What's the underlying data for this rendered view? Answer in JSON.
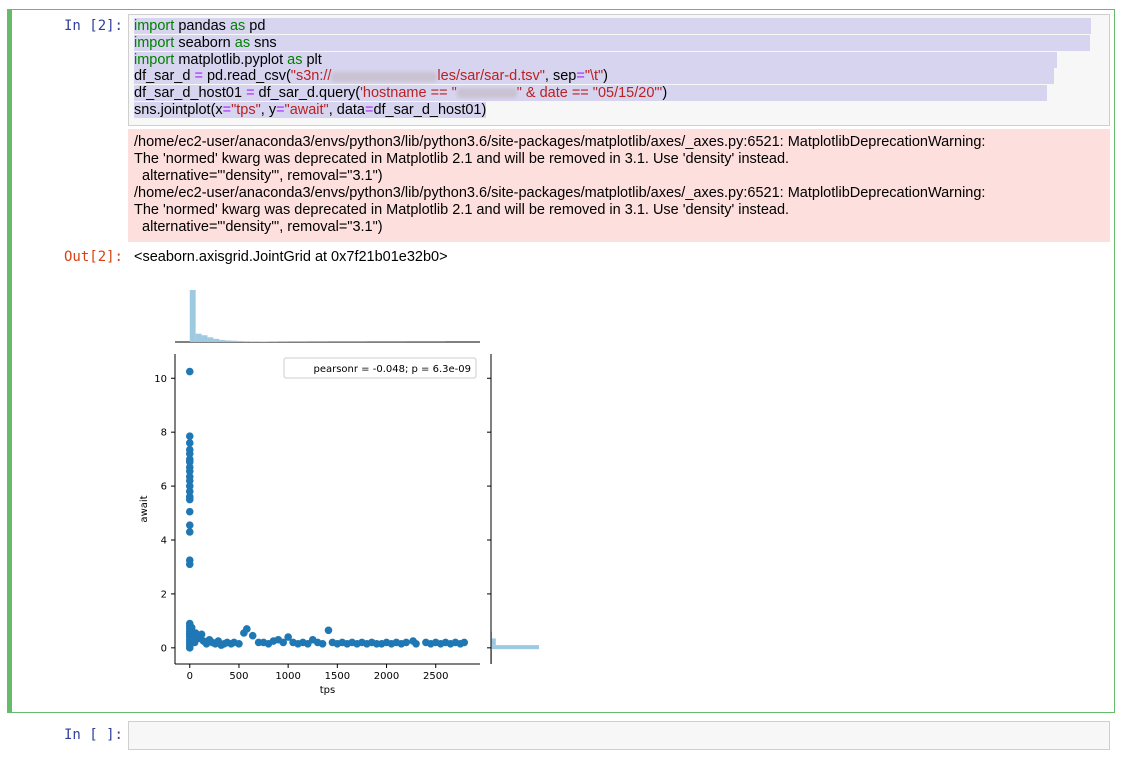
{
  "cell1": {
    "in_prompt": "In [2]:",
    "out_prompt": "Out[2]:",
    "code": {
      "line1": {
        "kw1": "import",
        "mod": " pandas ",
        "kw2": "as",
        "alias": " pd"
      },
      "line2": {
        "kw1": "import",
        "mod": " seaborn ",
        "kw2": "as",
        "alias": " sns"
      },
      "line3": {
        "kw1": "import",
        "mod": " matplotlib.pyplot ",
        "kw2": "as",
        "alias": " plt"
      },
      "line4": {
        "a": "df_sar_d ",
        "op": "=",
        "b": " pd.read_csv(",
        "s1": "\"s3n://",
        "s2": "les/sar/sar-d.tsv\"",
        "c": ", sep",
        "op2": "=",
        "s3": "\"\\t\"",
        "d": ")"
      },
      "line5": {
        "a": "df_sar_d_host01 ",
        "op": "=",
        "b": " df_sar_d.query(",
        "s1": "'hostname == \"",
        "s2": "\" & date == \"05/15/20\"'",
        "d": ")"
      },
      "line6": {
        "a": "sns.jointplot(x",
        "op1": "=",
        "s1": "\"tps\"",
        "b": ", y",
        "op2": "=",
        "s2": "\"await\"",
        "c": ", data",
        "op3": "=",
        "d": "df_sar_d_host01)"
      }
    },
    "stderr_lines": [
      "/home/ec2-user/anaconda3/envs/python3/lib/python3.6/site-packages/matplotlib/axes/_axes.py:6521: MatplotlibDeprecationWarning:",
      "The 'normed' kwarg was deprecated in Matplotlib 2.1 and will be removed in 3.1. Use 'density' instead.",
      "  alternative=\"'density'\", removal=\"3.1\")",
      "/home/ec2-user/anaconda3/envs/python3/lib/python3.6/site-packages/matplotlib/axes/_axes.py:6521: MatplotlibDeprecationWarning:",
      "The 'normed' kwarg was deprecated in Matplotlib 2.1 and will be removed in 3.1. Use 'density' instead.",
      "  alternative=\"'density'\", removal=\"3.1\")"
    ],
    "output_text": "<seaborn.axisgrid.JointGrid at 0x7f21b01e32b0>"
  },
  "cell2": {
    "in_prompt": "In [ ]:"
  },
  "chart_data": {
    "type": "scatter",
    "title": "",
    "xlabel": "tps",
    "ylabel": "await",
    "xlim": [
      -150,
      2950
    ],
    "ylim": [
      -0.6,
      10.9
    ],
    "xticks": [
      0,
      500,
      1000,
      1500,
      2000,
      2500
    ],
    "yticks": [
      0,
      2,
      4,
      6,
      8,
      10
    ],
    "annotation": "pearsonr = -0.048; p = 6.3e-09",
    "legend_position": "top-right",
    "grid": false,
    "colors": {
      "points": "#1f77b4",
      "hist": "#9ecae1"
    },
    "points": [
      [
        0,
        10.25
      ],
      [
        0,
        7.85
      ],
      [
        0,
        7.6
      ],
      [
        0,
        7.35
      ],
      [
        0,
        7.2
      ],
      [
        0,
        7.0
      ],
      [
        0,
        6.9
      ],
      [
        0,
        6.7
      ],
      [
        0,
        6.55
      ],
      [
        0,
        6.35
      ],
      [
        0,
        6.2
      ],
      [
        0,
        6.0
      ],
      [
        0,
        5.8
      ],
      [
        0,
        5.6
      ],
      [
        0,
        5.5
      ],
      [
        0,
        5.05
      ],
      [
        0,
        4.55
      ],
      [
        0,
        4.3
      ],
      [
        0,
        3.25
      ],
      [
        0,
        3.1
      ],
      [
        0,
        0.9
      ],
      [
        0,
        0.8
      ],
      [
        0,
        0.7
      ],
      [
        0,
        0.6
      ],
      [
        0,
        0.5
      ],
      [
        0,
        0.4
      ],
      [
        0,
        0.3
      ],
      [
        0,
        0.2
      ],
      [
        0,
        0.1
      ],
      [
        0,
        0.0
      ],
      [
        20,
        0.75
      ],
      [
        30,
        0.5
      ],
      [
        40,
        0.3
      ],
      [
        50,
        0.2
      ],
      [
        60,
        0.55
      ],
      [
        80,
        0.4
      ],
      [
        100,
        0.35
      ],
      [
        120,
        0.5
      ],
      [
        140,
        0.25
      ],
      [
        170,
        0.15
      ],
      [
        200,
        0.3
      ],
      [
        230,
        0.2
      ],
      [
        260,
        0.15
      ],
      [
        290,
        0.25
      ],
      [
        320,
        0.1
      ],
      [
        350,
        0.15
      ],
      [
        380,
        0.2
      ],
      [
        420,
        0.15
      ],
      [
        450,
        0.2
      ],
      [
        500,
        0.15
      ],
      [
        550,
        0.55
      ],
      [
        580,
        0.7
      ],
      [
        640,
        0.45
      ],
      [
        700,
        0.2
      ],
      [
        750,
        0.2
      ],
      [
        800,
        0.15
      ],
      [
        850,
        0.25
      ],
      [
        900,
        0.3
      ],
      [
        950,
        0.2
      ],
      [
        1000,
        0.4
      ],
      [
        1050,
        0.2
      ],
      [
        1100,
        0.15
      ],
      [
        1150,
        0.2
      ],
      [
        1200,
        0.15
      ],
      [
        1250,
        0.3
      ],
      [
        1300,
        0.2
      ],
      [
        1350,
        0.15
      ],
      [
        1410,
        0.65
      ],
      [
        1450,
        0.2
      ],
      [
        1500,
        0.15
      ],
      [
        1550,
        0.2
      ],
      [
        1600,
        0.15
      ],
      [
        1650,
        0.2
      ],
      [
        1700,
        0.15
      ],
      [
        1750,
        0.2
      ],
      [
        1800,
        0.15
      ],
      [
        1850,
        0.2
      ],
      [
        1900,
        0.15
      ],
      [
        1950,
        0.15
      ],
      [
        2000,
        0.2
      ],
      [
        2050,
        0.15
      ],
      [
        2100,
        0.2
      ],
      [
        2150,
        0.15
      ],
      [
        2200,
        0.2
      ],
      [
        2270,
        0.25
      ],
      [
        2300,
        0.15
      ],
      [
        2400,
        0.2
      ],
      [
        2450,
        0.15
      ],
      [
        2500,
        0.2
      ],
      [
        2550,
        0.15
      ],
      [
        2600,
        0.2
      ],
      [
        2650,
        0.15
      ],
      [
        2700,
        0.2
      ],
      [
        2750,
        0.15
      ],
      [
        2790,
        0.2
      ]
    ],
    "top_hist": {
      "bins": [
        0,
        60,
        120,
        180,
        240,
        300,
        360,
        420,
        480,
        540,
        600,
        700,
        800,
        900,
        1000,
        1200,
        1400,
        1600,
        1800,
        2000,
        2200,
        2400,
        2600
      ],
      "counts": [
        1.0,
        0.16,
        0.13,
        0.09,
        0.06,
        0.04,
        0.03,
        0.025,
        0.02,
        0.015,
        0.012,
        0.01,
        0.008,
        0.007,
        0.006,
        0.005,
        0.004,
        0.004,
        0.003,
        0.003,
        0.002,
        0.002
      ]
    },
    "right_hist": {
      "bins": [
        -0.6,
        -0.05,
        0.1,
        0.35,
        0.6
      ],
      "counts": [
        0.02,
        1.0,
        0.1,
        0.02
      ]
    }
  }
}
